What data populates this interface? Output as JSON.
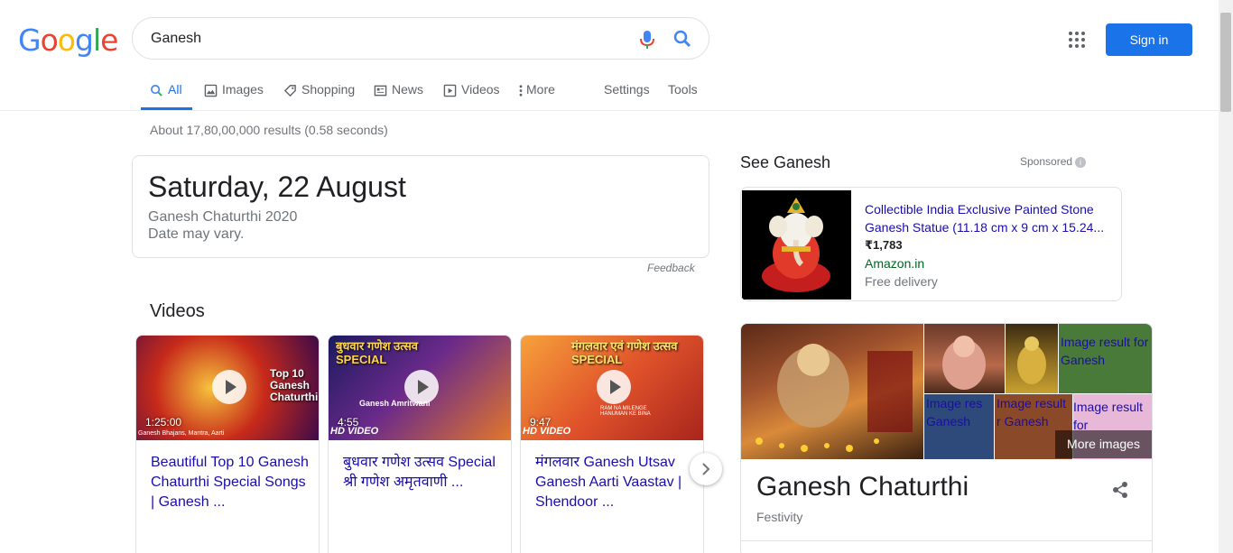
{
  "header": {
    "logo_letters": [
      {
        "ch": "G",
        "color": "#4285f4"
      },
      {
        "ch": "o",
        "color": "#ea4335"
      },
      {
        "ch": "o",
        "color": "#fbbc05"
      },
      {
        "ch": "g",
        "color": "#4285f4"
      },
      {
        "ch": "l",
        "color": "#34a853"
      },
      {
        "ch": "e",
        "color": "#ea4335"
      }
    ],
    "query": "Ganesh",
    "sign_in": "Sign in"
  },
  "tabs": {
    "all": "All",
    "images": "Images",
    "shopping": "Shopping",
    "news": "News",
    "videos": "Videos",
    "more": "More",
    "settings": "Settings",
    "tools": "Tools"
  },
  "stats": "About 17,80,00,000 results (0.58 seconds)",
  "date_card": {
    "title": "Saturday, 22 August",
    "event": "Ganesh Chaturthi 2020",
    "note": "Date may vary.",
    "feedback": "Feedback"
  },
  "videos": {
    "heading": "Videos",
    "items": [
      {
        "duration": "1:25:00",
        "title": "Beautiful Top 10 Ganesh Chaturthi Special Songs | Ganesh ...",
        "thumb_text": "Top 10 Ganesh Chaturthi",
        "thumb_footer": "Ganesh Bhajans, Mantra, Aarti"
      },
      {
        "duration": "4:55",
        "title": "बुधवार गणेश उत्सव Special श्री गणेश अमृतवाणी ...",
        "thumb_text": "बुधवार गणेश उत्सव SPECIAL",
        "thumb_footer": "Ganesh Amritwani",
        "badge": "HD VIDEO"
      },
      {
        "duration": "9:47",
        "title": "मंगलवार Ganesh Utsav Ganesh Aarti Vaastav | Shendoor ...",
        "thumb_text": "मंगलवार एवं गणेश उत्सव SPECIAL",
        "thumb_footer": "RAM NA MILENGE HANUMAN KE BINA",
        "badge": "HD VIDEO"
      }
    ]
  },
  "shopping": {
    "heading": "See Ganesh",
    "sponsored": "Sponsored",
    "product_title": "Collectible India Exclusive Painted Stone Ganesh Statue (11.18 cm x 9 cm x 15.24...",
    "price": "₹1,783",
    "store": "Amazon.in",
    "shipping": "Free delivery"
  },
  "knowledge_panel": {
    "broken_images": [
      "Image result for Ganesh",
      "Image res Ganesh",
      "Image result r Ganesh",
      "Image result for"
    ],
    "more_images": "More images",
    "title": "Ganesh Chaturthi",
    "subtitle": "Festivity"
  }
}
